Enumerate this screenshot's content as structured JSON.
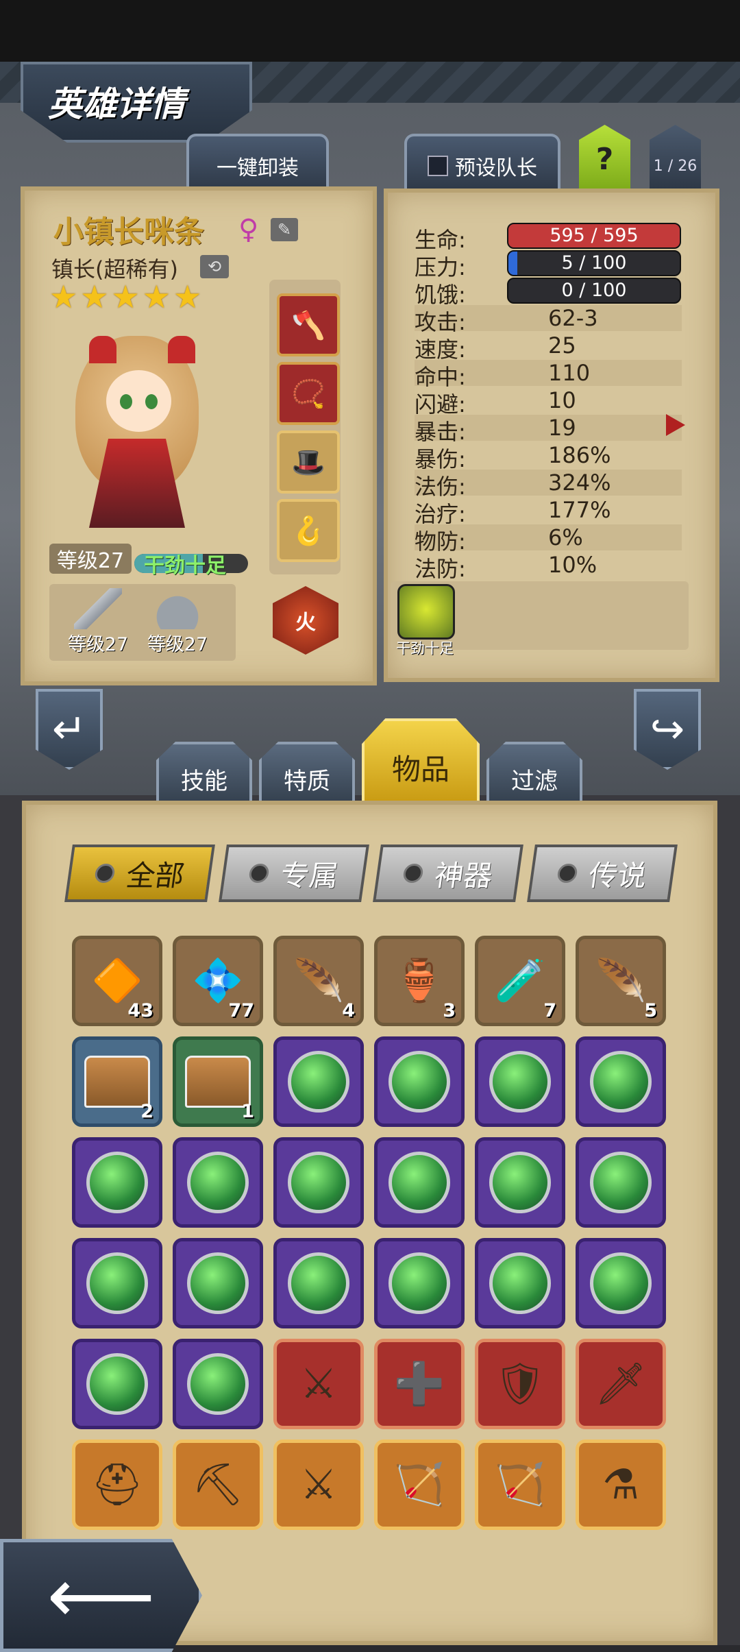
{
  "header": {
    "title": "英雄详情"
  },
  "top_tabs": {
    "unequip_label": "一键卸装",
    "preset_leader_label": "预设队长",
    "help_label": "?",
    "page_counter": "1 / 26"
  },
  "hero": {
    "name": "小镇长咪条",
    "gender_icon": "female-icon",
    "class": "镇长(超稀有)",
    "stars": 5,
    "level_label": "等级27",
    "mood_label": "干劲十足",
    "mood_level": 0.6,
    "weapon_level": "等级27",
    "armor_level": "等级27",
    "element_label": "火"
  },
  "stats": {
    "hp": {
      "label": "生命:",
      "value": "595 / 595",
      "fraction": 1.0,
      "color": "#c33a3a"
    },
    "stress": {
      "label": "压力:",
      "value": "5 / 100",
      "fraction": 0.05,
      "color": "#2f6ad8"
    },
    "hunger": {
      "label": "饥饿:",
      "value": "0 / 100",
      "fraction": 0.0,
      "color": "#888888"
    },
    "rows": [
      {
        "label": "攻击:",
        "value": "62-3"
      },
      {
        "label": "速度:",
        "value": "25"
      },
      {
        "label": "命中:",
        "value": "110"
      },
      {
        "label": "闪避:",
        "value": "10"
      },
      {
        "label": "暴击:",
        "value": "19"
      },
      {
        "label": "暴伤:",
        "value": "186%"
      },
      {
        "label": "法伤:",
        "value": "324%"
      },
      {
        "label": "治疗:",
        "value": "177%"
      },
      {
        "label": "物防:",
        "value": "6%"
      },
      {
        "label": "法防:",
        "value": "10%"
      }
    ],
    "trait_label": "干劲十足"
  },
  "inventory_tabs": [
    {
      "label": "技能",
      "active": false
    },
    {
      "label": "特质",
      "active": false
    },
    {
      "label": "物品",
      "active": true
    },
    {
      "label": "过滤",
      "active": false
    }
  ],
  "filters": [
    {
      "label": "全部",
      "active": true
    },
    {
      "label": "专属",
      "active": false
    },
    {
      "label": "神器",
      "active": false
    },
    {
      "label": "传说",
      "active": false
    }
  ],
  "items": [
    {
      "name": "amber-rune-icon",
      "rarity": "brown",
      "glyph": "🔶",
      "count": "43"
    },
    {
      "name": "crystal-shard-icon",
      "rarity": "brown",
      "glyph": "💠",
      "count": "77"
    },
    {
      "name": "phoenix-feather-icon",
      "rarity": "brown",
      "glyph": "🪶",
      "count": "4"
    },
    {
      "name": "blue-potion-icon",
      "rarity": "brown",
      "glyph": "🏺",
      "count": "3"
    },
    {
      "name": "purple-flask-icon",
      "rarity": "brown",
      "glyph": "🧪",
      "count": "7"
    },
    {
      "name": "white-feather-icon",
      "rarity": "brown",
      "glyph": "🪶",
      "count": "5"
    },
    {
      "name": "blue-chest-icon",
      "rarity": "blue",
      "glyph": "chest",
      "count": "2"
    },
    {
      "name": "green-chest-icon",
      "rarity": "green",
      "glyph": "chest",
      "count": "1"
    },
    {
      "name": "green-gem-icon",
      "rarity": "purple",
      "glyph": "gem",
      "count": ""
    },
    {
      "name": "green-gem-icon",
      "rarity": "purple",
      "glyph": "gem",
      "count": ""
    },
    {
      "name": "green-gem-icon",
      "rarity": "purple",
      "glyph": "gem",
      "count": ""
    },
    {
      "name": "green-gem-icon",
      "rarity": "purple",
      "glyph": "gem",
      "count": ""
    },
    {
      "name": "green-gem-icon",
      "rarity": "purple",
      "glyph": "gem",
      "count": ""
    },
    {
      "name": "green-gem-icon",
      "rarity": "purple",
      "glyph": "gem",
      "count": ""
    },
    {
      "name": "green-gem-icon",
      "rarity": "purple",
      "glyph": "gem",
      "count": ""
    },
    {
      "name": "green-gem-icon",
      "rarity": "purple",
      "glyph": "gem",
      "count": ""
    },
    {
      "name": "green-gem-icon",
      "rarity": "purple",
      "glyph": "gem",
      "count": ""
    },
    {
      "name": "green-gem-icon",
      "rarity": "purple",
      "glyph": "gem",
      "count": ""
    },
    {
      "name": "green-gem-icon",
      "rarity": "purple",
      "glyph": "gem",
      "count": ""
    },
    {
      "name": "green-gem-icon",
      "rarity": "purple",
      "glyph": "gem",
      "count": ""
    },
    {
      "name": "green-gem-icon",
      "rarity": "purple",
      "glyph": "gem",
      "count": ""
    },
    {
      "name": "green-gem-icon",
      "rarity": "purple",
      "glyph": "gem",
      "count": ""
    },
    {
      "name": "green-gem-icon",
      "rarity": "purple",
      "glyph": "gem",
      "count": ""
    },
    {
      "name": "green-gem-icon",
      "rarity": "purple",
      "glyph": "gem",
      "count": ""
    },
    {
      "name": "green-gem-icon",
      "rarity": "purple",
      "glyph": "gem",
      "count": ""
    },
    {
      "name": "green-gem-icon",
      "rarity": "purple",
      "glyph": "gem",
      "count": ""
    },
    {
      "name": "crossed-axes-icon",
      "rarity": "red",
      "glyph": "⚔",
      "count": ""
    },
    {
      "name": "medkit-icon",
      "rarity": "red",
      "glyph": "➕",
      "count": ""
    },
    {
      "name": "red-armor-icon",
      "rarity": "red",
      "glyph": "🛡",
      "count": ""
    },
    {
      "name": "green-blade-icon",
      "rarity": "red",
      "glyph": "🗡",
      "count": ""
    },
    {
      "name": "horn-helmet-icon",
      "rarity": "orange",
      "glyph": "⛑",
      "count": ""
    },
    {
      "name": "pickaxe-icon",
      "rarity": "orange",
      "glyph": "⛏",
      "count": ""
    },
    {
      "name": "crossed-swords-icon",
      "rarity": "orange",
      "glyph": "⚔",
      "count": ""
    },
    {
      "name": "crossbow-icon",
      "rarity": "orange",
      "glyph": "🏹",
      "count": ""
    },
    {
      "name": "scythe-crossbow-icon",
      "rarity": "orange",
      "glyph": "🏹",
      "count": ""
    },
    {
      "name": "green-pot-icon",
      "rarity": "orange",
      "glyph": "⚗",
      "count": ""
    }
  ]
}
